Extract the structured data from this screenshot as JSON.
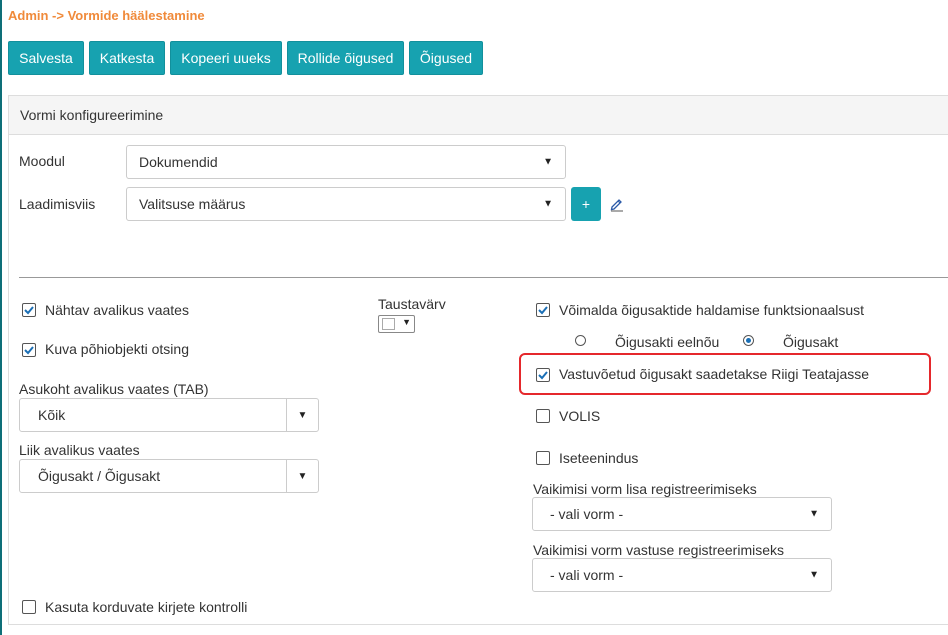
{
  "breadcrumb": "Admin -> Vormide häälestamine",
  "toolbar": {
    "save": "Salvesta",
    "cancel": "Katkesta",
    "copy_new": "Kopeeri uueks",
    "role_rights": "Rollide õigused",
    "rights": "Õigused"
  },
  "panel": {
    "title": "Vormi konfigureerimine"
  },
  "module": {
    "label": "Moodul",
    "value": "Dokumendid"
  },
  "method": {
    "label": "Laadimisviis",
    "value": "Valitsuse määrus",
    "add_label": "+"
  },
  "left": {
    "visible_public_label": "Nähtav avalikus vaates",
    "visible_public_checked": true,
    "show_main_object_search_label": "Kuva põhiobjekti otsing",
    "show_main_object_search_checked": true,
    "tab_location_label": "Asukoht avalikus vaates (TAB)",
    "tab_location_value": "Kõik",
    "type_public_label": "Liik avalikus vaates",
    "type_public_value": "Õigusakt / Õigusakt",
    "duplicate_check_label": "Kasuta korduvate kirjete kontrolli",
    "duplicate_check_checked": false
  },
  "middle": {
    "bg_color_label": "Taustavärv"
  },
  "right": {
    "enable_legal_acts_label": "Võimalda õigusaktide haldamise funktsionaalsust",
    "enable_legal_acts_checked": true,
    "radio_draft_label": "Õigusakti eelnõu",
    "radio_act_label": "Õigusakt",
    "radio_selected": "Õigusakt",
    "send_to_rt_label": "Vastuvõetud õigusakt saadetakse Riigi Teatajasse",
    "send_to_rt_checked": true,
    "volis_label": "VOLIS",
    "volis_checked": false,
    "self_service_label": "Iseteenindus",
    "self_service_checked": false,
    "default_form_add_label": "Vaikimisi vorm lisa registreerimiseks",
    "default_form_add_value": "- vali vorm -",
    "default_form_reply_label": "Vaikimisi vorm vastuse registreerimiseks",
    "default_form_reply_value": "- vali vorm -"
  },
  "colors": {
    "accent": "#17a2b0",
    "breadcrumb": "#f08a3a",
    "highlight": "#e5282c"
  }
}
